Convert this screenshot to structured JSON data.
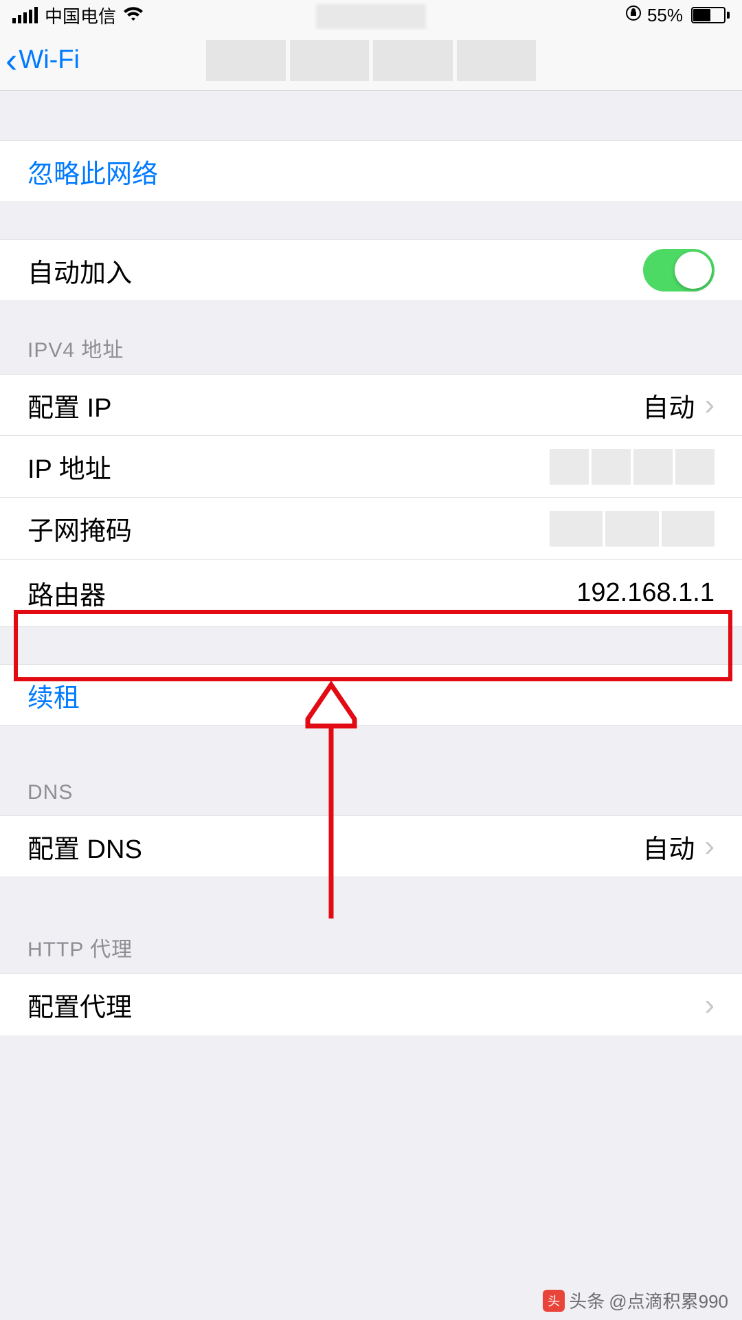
{
  "status": {
    "carrier": "中国电信",
    "battery_pct": "55%"
  },
  "nav": {
    "back_label": "Wi-Fi"
  },
  "cells": {
    "forget": "忽略此网络",
    "auto_join": "自动加入",
    "renew": "续租"
  },
  "ipv4": {
    "header": "IPV4 地址",
    "config_ip_label": "配置 IP",
    "config_ip_value": "自动",
    "ip_label": "IP 地址",
    "subnet_label": "子网掩码",
    "router_label": "路由器",
    "router_value": "192.168.1.1"
  },
  "dns": {
    "header": "DNS",
    "config_label": "配置 DNS",
    "config_value": "自动"
  },
  "proxy": {
    "header": "HTTP 代理",
    "config_label": "配置代理"
  },
  "watermark": {
    "prefix": "头条",
    "text": "@点滴积累990"
  }
}
